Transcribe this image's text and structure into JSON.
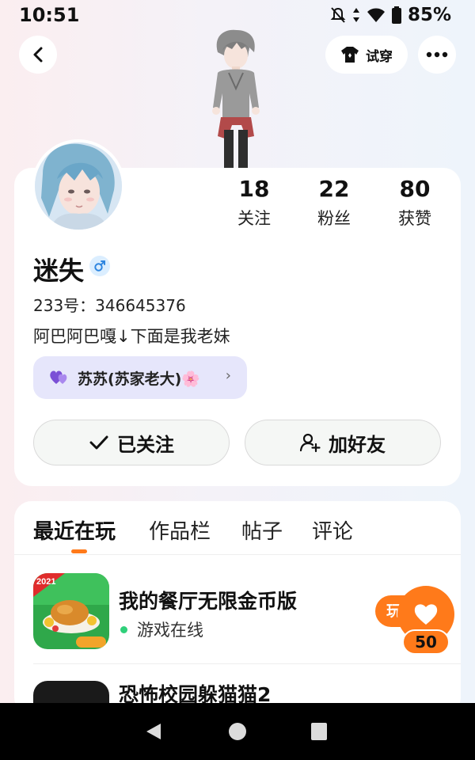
{
  "status_bar": {
    "time": "10:51",
    "battery_percent": "85%"
  },
  "header": {
    "tryon_label": "试穿"
  },
  "profile": {
    "stats": [
      {
        "value": "18",
        "label": "关注"
      },
      {
        "value": "22",
        "label": "粉丝"
      },
      {
        "value": "80",
        "label": "获赞"
      }
    ],
    "username": "迷失",
    "gender": "male",
    "id_text": "233号：346645376",
    "bio": "阿巴阿巴嘎↓下面是我老妹",
    "family_tag": "苏苏(苏家老大)🌸",
    "followed_label": "已关注",
    "add_friend_label": "加好友"
  },
  "tabs": [
    "最近在玩",
    "作品栏",
    "帖子",
    "评论"
  ],
  "games": [
    {
      "title": "我的餐厅无限金币版",
      "status": "游戏在线",
      "play_label": "玩"
    },
    {
      "title": "恐怖校园躲猫猫2"
    }
  ],
  "like_fab": {
    "count": "50"
  },
  "icons": {
    "back": "back-arrow-icon",
    "shirt": "shirt-icon",
    "more": "more-icon",
    "heart": "heart-icon"
  },
  "colors": {
    "accent": "#ff7a1a",
    "family_tag_bg": "#e6e6fb",
    "online": "#2fd07a"
  }
}
